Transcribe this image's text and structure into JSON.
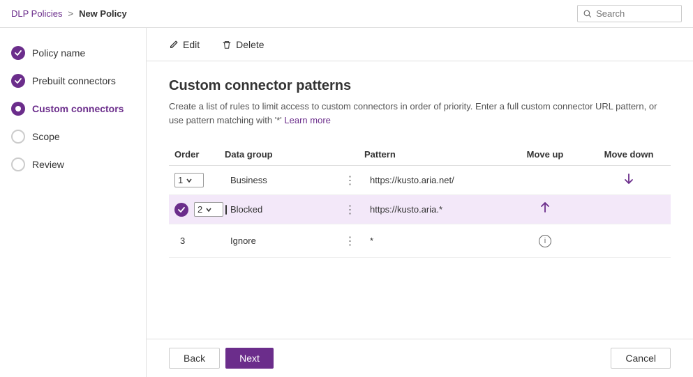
{
  "breadcrumb": {
    "parent": "DLP Policies",
    "separator": ">",
    "current": "New Policy"
  },
  "search": {
    "placeholder": "Search"
  },
  "toolbar": {
    "edit_label": "Edit",
    "delete_label": "Delete"
  },
  "sidebar": {
    "items": [
      {
        "id": "policy-name",
        "label": "Policy name",
        "state": "done"
      },
      {
        "id": "prebuilt-connectors",
        "label": "Prebuilt connectors",
        "state": "done"
      },
      {
        "id": "custom-connectors",
        "label": "Custom connectors",
        "state": "active"
      },
      {
        "id": "scope",
        "label": "Scope",
        "state": "empty"
      },
      {
        "id": "review",
        "label": "Review",
        "state": "empty"
      }
    ]
  },
  "page": {
    "title": "Custom connector patterns",
    "description": "Create a list of rules to limit access to custom connectors in order of priority. Enter a full custom connector URL pattern, or use pattern matching with '*'",
    "learn_more": "Learn more"
  },
  "table": {
    "headers": [
      "Order",
      "Data group",
      "",
      "Pattern",
      "Move up",
      "Move down"
    ],
    "rows": [
      {
        "order": "1",
        "order_dropdown": true,
        "data_group": "Business",
        "pattern": "https://kusto.aria.net/",
        "has_move_up": false,
        "has_move_down": true,
        "highlighted": false,
        "has_check": false
      },
      {
        "order": "2",
        "order_dropdown": true,
        "data_group": "Blocked",
        "pattern": "https://kusto.aria.*",
        "has_move_up": true,
        "has_move_down": false,
        "highlighted": true,
        "has_check": true
      },
      {
        "order": "3",
        "order_dropdown": false,
        "data_group": "Ignore",
        "pattern": "*",
        "has_move_up": false,
        "has_move_down": false,
        "highlighted": false,
        "has_check": false,
        "has_info": true
      }
    ]
  },
  "footer": {
    "back_label": "Back",
    "next_label": "Next",
    "cancel_label": "Cancel"
  }
}
